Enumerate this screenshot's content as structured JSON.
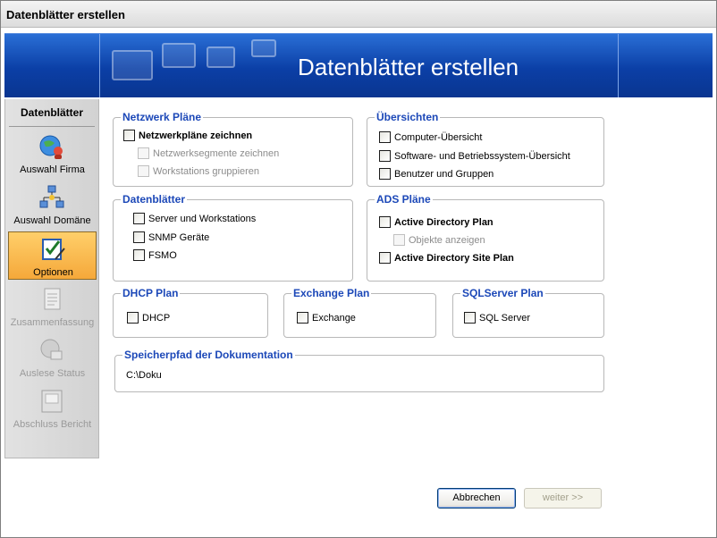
{
  "window": {
    "title": "Datenblätter erstellen"
  },
  "banner": {
    "title": "Datenblätter erstellen"
  },
  "sidebar": {
    "heading": "Datenblätter",
    "items": [
      {
        "label": "Auswahl Firma",
        "icon": "globe-user-icon",
        "state": "normal"
      },
      {
        "label": "Auswahl Domäne",
        "icon": "network-icon",
        "state": "normal"
      },
      {
        "label": "Optionen",
        "icon": "checklist-icon",
        "state": "active"
      },
      {
        "label": "Zusammenfassung",
        "icon": "document-icon",
        "state": "disabled"
      },
      {
        "label": "Auslese Status",
        "icon": "globe-status-icon",
        "state": "disabled"
      },
      {
        "label": "Abschluss Bericht",
        "icon": "report-icon",
        "state": "disabled"
      }
    ]
  },
  "groups": {
    "netzwerk": {
      "title": "Netzwerk Pläne",
      "main": "Netzwerkpläne zeichnen",
      "sub1": "Netzwerksegmente zeichnen",
      "sub2": "Workstations gruppieren"
    },
    "uebersichten": {
      "title": "Übersichten",
      "item1": "Computer-Übersicht",
      "item2": "Software- und Betriebssystem-Übersicht",
      "item3": "Benutzer und Gruppen"
    },
    "datenblaetter": {
      "title": "Datenblätter",
      "item1": "Server und Workstations",
      "item2": "SNMP Geräte",
      "item3": "FSMO"
    },
    "ads": {
      "title": "ADS Pläne",
      "item1": "Active Directory Plan",
      "sub1": "Objekte anzeigen",
      "item2": "Active Directory Site Plan"
    },
    "dhcp": {
      "title": "DHCP Plan",
      "item": "DHCP"
    },
    "exchange": {
      "title": "Exchange Plan",
      "item": "Exchange"
    },
    "sql": {
      "title": "SQLServer Plan",
      "item": "SQL Server"
    },
    "speicherpfad": {
      "title": "Speicherpfad der Dokumentation",
      "value": "C:\\Doku"
    }
  },
  "buttons": {
    "cancel": "Abbrechen",
    "next": "weiter >>"
  },
  "colors": {
    "accent": "#1c48b8",
    "banner": "#0b3fa6",
    "active_nav": "#f5a83a"
  }
}
